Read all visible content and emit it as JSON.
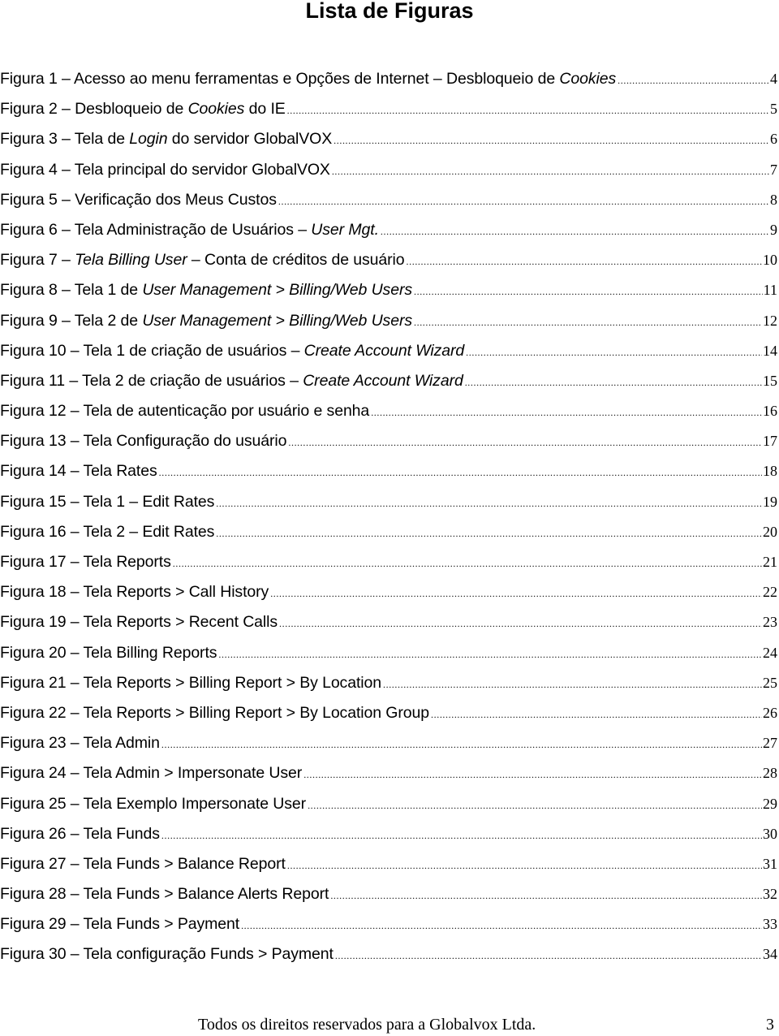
{
  "document": {
    "title": "Lista de Figuras",
    "entries": [
      {
        "segments": [
          {
            "text": "Figura 1 – Acesso ao menu ferramentas e Opções de Internet – Desbloqueio de "
          },
          {
            "text": "Cookies",
            "italic": true
          }
        ],
        "page": "4"
      },
      {
        "segments": [
          {
            "text": "Figura 2 – Desbloqueio de "
          },
          {
            "text": "Cookies",
            "italic": true
          },
          {
            "text": " do IE"
          }
        ],
        "page": "5"
      },
      {
        "segments": [
          {
            "text": "Figura 3 – Tela de "
          },
          {
            "text": "Login",
            "italic": true
          },
          {
            "text": " do servidor GlobalVOX "
          }
        ],
        "page": "6"
      },
      {
        "segments": [
          {
            "text": "Figura 4 – Tela principal do servidor GlobalVOX"
          }
        ],
        "page": "7"
      },
      {
        "segments": [
          {
            "text": "Figura 5 – Verificação dos Meus Custos"
          }
        ],
        "page": "8"
      },
      {
        "segments": [
          {
            "text": "Figura 6 – Tela Administração de Usuários – "
          },
          {
            "text": "User Mgt.",
            "italic": true
          },
          {
            "text": " "
          }
        ],
        "page": "9"
      },
      {
        "segments": [
          {
            "text": "Figura 7 – "
          },
          {
            "text": "Tela Billing User",
            "italic": true
          },
          {
            "text": " – Conta de créditos de usuário"
          }
        ],
        "page": "10"
      },
      {
        "segments": [
          {
            "text": "Figura 8 – Tela 1 de "
          },
          {
            "text": "User Management > Billing/Web Users",
            "italic": true
          }
        ],
        "page": "11"
      },
      {
        "segments": [
          {
            "text": "Figura 9 – Tela 2 de "
          },
          {
            "text": "User Management > Billing/Web Users",
            "italic": true
          }
        ],
        "page": "12"
      },
      {
        "segments": [
          {
            "text": "Figura 10 – Tela 1 de criação de usuários – "
          },
          {
            "text": "Create Account Wizard",
            "italic": true
          },
          {
            "text": " "
          }
        ],
        "page": "14"
      },
      {
        "segments": [
          {
            "text": "Figura 11 – Tela 2 de criação de usuários – "
          },
          {
            "text": "Create Account Wizard",
            "italic": true
          },
          {
            "text": " "
          }
        ],
        "page": "15"
      },
      {
        "segments": [
          {
            "text": "Figura 12 – Tela de autenticação por usuário e senha"
          }
        ],
        "page": "16"
      },
      {
        "segments": [
          {
            "text": "Figura 13 – Tela Configuração do usuário"
          }
        ],
        "page": "17"
      },
      {
        "segments": [
          {
            "text": "Figura 14 – Tela Rates"
          }
        ],
        "page": "18"
      },
      {
        "segments": [
          {
            "text": "Figura 15 – Tela 1 – Edit Rates "
          }
        ],
        "page": "19"
      },
      {
        "segments": [
          {
            "text": "Figura 16 – Tela 2 – Edit Rates "
          }
        ],
        "page": "20"
      },
      {
        "segments": [
          {
            "text": "Figura 17 – Tela Reports"
          }
        ],
        "page": "21"
      },
      {
        "segments": [
          {
            "text": "Figura 18 – Tela Reports > Call History"
          }
        ],
        "page": "22"
      },
      {
        "segments": [
          {
            "text": "Figura 19 – Tela Reports > Recent Calls "
          }
        ],
        "page": "23"
      },
      {
        "segments": [
          {
            "text": "Figura 20 – Tela Billing Reports"
          }
        ],
        "page": "24"
      },
      {
        "segments": [
          {
            "text": "Figura 21 – Tela Reports > Billing Report > By Location"
          }
        ],
        "page": "25"
      },
      {
        "segments": [
          {
            "text": "Figura 22 – Tela Reports > Billing Report > By Location Group"
          }
        ],
        "page": "26"
      },
      {
        "segments": [
          {
            "text": "Figura 23 – Tela Admin "
          }
        ],
        "page": "27"
      },
      {
        "segments": [
          {
            "text": "Figura 24 – Tela Admin > Impersonate User "
          }
        ],
        "page": "28"
      },
      {
        "segments": [
          {
            "text": "Figura 25 – Tela Exemplo Impersonate User "
          }
        ],
        "page": "29"
      },
      {
        "segments": [
          {
            "text": "Figura 26 – Tela Funds "
          }
        ],
        "page": "30"
      },
      {
        "segments": [
          {
            "text": "Figura 27 – Tela Funds > Balance Report "
          }
        ],
        "page": "31"
      },
      {
        "segments": [
          {
            "text": "Figura 28 – Tela Funds > Balance Alerts Report"
          }
        ],
        "page": "32"
      },
      {
        "segments": [
          {
            "text": "Figura 29 – Tela Funds > Payment "
          }
        ],
        "page": "33"
      },
      {
        "segments": [
          {
            "text": "Figura 30 – Tela configuração Funds > Payment "
          }
        ],
        "page": "34"
      }
    ]
  },
  "footer": {
    "text": "Todos os direitos reservados para a Globalvox Ltda.",
    "page_number": "3"
  }
}
